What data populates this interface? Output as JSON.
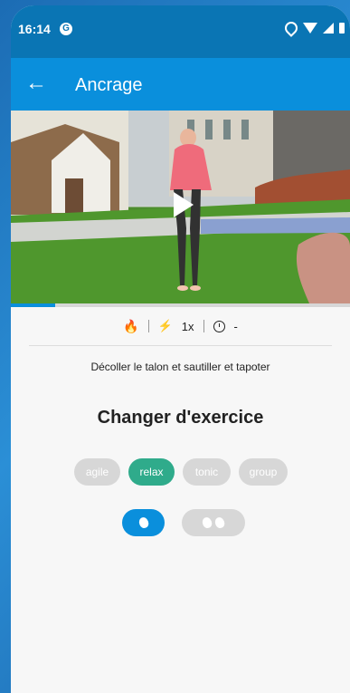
{
  "status_bar": {
    "time": "16:14",
    "app_icon": "chrome-icon"
  },
  "app_bar": {
    "title": "Ancrage",
    "back_icon": "arrow-left-icon"
  },
  "video": {
    "progress_percent": 13,
    "play_icon": "play-icon"
  },
  "meta": {
    "intensity_icon": "flame-icon",
    "speed_label": "1x",
    "speed_icon": "bolt-icon",
    "duration_label": "-",
    "duration_icon": "clock-icon"
  },
  "instruction": "Décoller  le talon et sautiller et tapoter",
  "section_title": "Changer d'exercice",
  "chips": [
    {
      "label": "agile",
      "active": false,
      "color": "#d7d7d7"
    },
    {
      "label": "relax",
      "active": true,
      "color": "#2fab8b"
    },
    {
      "label": "tonic",
      "active": false,
      "color": "#d7d7d7"
    },
    {
      "label": "group",
      "active": false,
      "color": "#d7d7d7"
    }
  ],
  "intensity_buttons": [
    {
      "icon": "flame-icon",
      "count": 1,
      "active": true,
      "color": "#0a8fdc"
    },
    {
      "icon": "flame-icon",
      "count": 2,
      "active": false,
      "color": "#d7d7d7"
    }
  ],
  "colors": {
    "status_bar": "#0a75b4",
    "app_bar": "#0a8fdc",
    "background": "#f7f7f7"
  }
}
